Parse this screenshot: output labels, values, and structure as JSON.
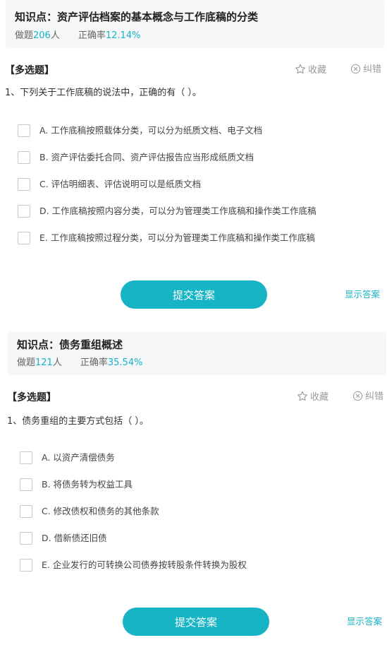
{
  "questions": [
    {
      "knowledge_point": "知识点：资产评估档案的基本概念与工作底稿的分类",
      "done_label": "做题",
      "done_count": "206",
      "done_unit": "人",
      "accuracy_label": "正确率",
      "accuracy_value": "12.14%",
      "question_type": "【多选题】",
      "favorite_label": "收藏",
      "report_label": "纠错",
      "question_text": "1、下列关于工作底稿的说法中，正确的有（    ）。",
      "options": [
        "A. 工作底稿按照载体分类，可以分为纸质文档、电子文档",
        "B. 资产评估委托合同、资产评估报告应当形成纸质文档",
        "C. 评估明细表、评估说明可以是纸质文档",
        "D. 工作底稿按照内容分类，可以分为管理类工作底稿和操作类工作底稿",
        "E. 工作底稿按照过程分类，可以分为管理类工作底稿和操作类工作底稿"
      ],
      "submit_label": "提交答案",
      "show_answer_label": "显示答案"
    },
    {
      "knowledge_point": "知识点：债务重组概述",
      "done_label": "做题",
      "done_count": "121",
      "done_unit": "人",
      "accuracy_label": "正确率",
      "accuracy_value": "35.54%",
      "question_type": "【多选题】",
      "favorite_label": "收藏",
      "report_label": "纠错",
      "question_text": "1、债务重组的主要方式包括（    ）。",
      "options": [
        "A. 以资产清偿债务",
        "B. 将债务转为权益工具",
        "C. 修改债权和债务的其他条款",
        "D. 借新债还旧债",
        "E. 企业发行的可转换公司债券按转股条件转换为股权"
      ],
      "submit_label": "提交答案",
      "show_answer_label": "显示答案"
    }
  ],
  "icons": {
    "favorite": "star-outline-icon",
    "report": "circle-x-icon"
  },
  "colors": {
    "accent": "#17b4c6",
    "card_background": "#f5f6f7",
    "muted_text": "#9a9a9a"
  }
}
